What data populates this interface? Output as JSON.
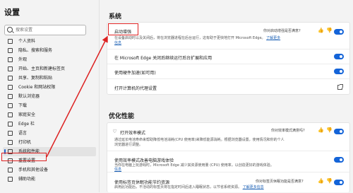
{
  "sidebar": {
    "title": "设置",
    "search_placeholder": "搜索设置",
    "items": [
      {
        "label": "个人资料"
      },
      {
        "label": "隐私、搜索和服务"
      },
      {
        "label": "外观"
      },
      {
        "label": "开始、主页和新建标签页"
      },
      {
        "label": "共享、复制和粘贴"
      },
      {
        "label": "Cookie 和网站权限"
      },
      {
        "label": "默认浏览器"
      },
      {
        "label": "下载"
      },
      {
        "label": "家庭安全"
      },
      {
        "label": "Edge 栏"
      },
      {
        "label": "语言"
      },
      {
        "label": "打印机"
      },
      {
        "label": "系统和性能"
      },
      {
        "label": "重置设置"
      },
      {
        "label": "手机和其他设备"
      },
      {
        "label": "辅助功能"
      }
    ],
    "active_index": 12
  },
  "system": {
    "heading": "系统",
    "feedback_question": "你对启动增强是否满意?",
    "startup_boost": {
      "title": "启动增强",
      "desc_line1": "在设备启动时以及关闭后，将在浏览器进程在后台运行，这有助于更快地打开 Microsoft Edge。",
      "learn_more": "了解更多",
      "desc_line2": "信息"
    },
    "background_apps": {
      "title": "在 Microsoft Edge 关闭后继续运行后台扩展和应用"
    },
    "hw_accel": {
      "title": "使用硬件加速(如可用)"
    },
    "proxy": {
      "title": "打开计算机的代理设置"
    }
  },
  "perf": {
    "heading": "优化性能",
    "efficiency": {
      "title": "打开效率模式",
      "feedback_question": "你对效率模式满意吗?",
      "desc_line1": "通过延长电池寿命来帮助降低电池消耗(CPU 使用率)来降低能源消耗。根据浏览器设置，使用情况和你的个人",
      "desc_line2": "浏览器进行调整。"
    },
    "game_efficiency": {
      "title": "使用效率模式改善电脑游戏体验",
      "desc_line1": "当你在电脑上玩游戏时，Microsoft Edge 减少其资源使用量 (CPU) 使用率，以创造更好的游戏体验。",
      "desc_line2": "信息"
    },
    "sleeping_tabs": {
      "title": "使用标签页休眠功能节约资源",
      "feedback_question": "你对标签页休眠功能是否满意?",
      "desc_line1": "启用此功能后，不活动的标签页将在指定时间后进入睡眠状态，以节省系统资源。",
      "learn_more": "了解更多信息"
    }
  },
  "colors": {
    "accent": "#1464d8",
    "annotation": "#dd2222"
  }
}
